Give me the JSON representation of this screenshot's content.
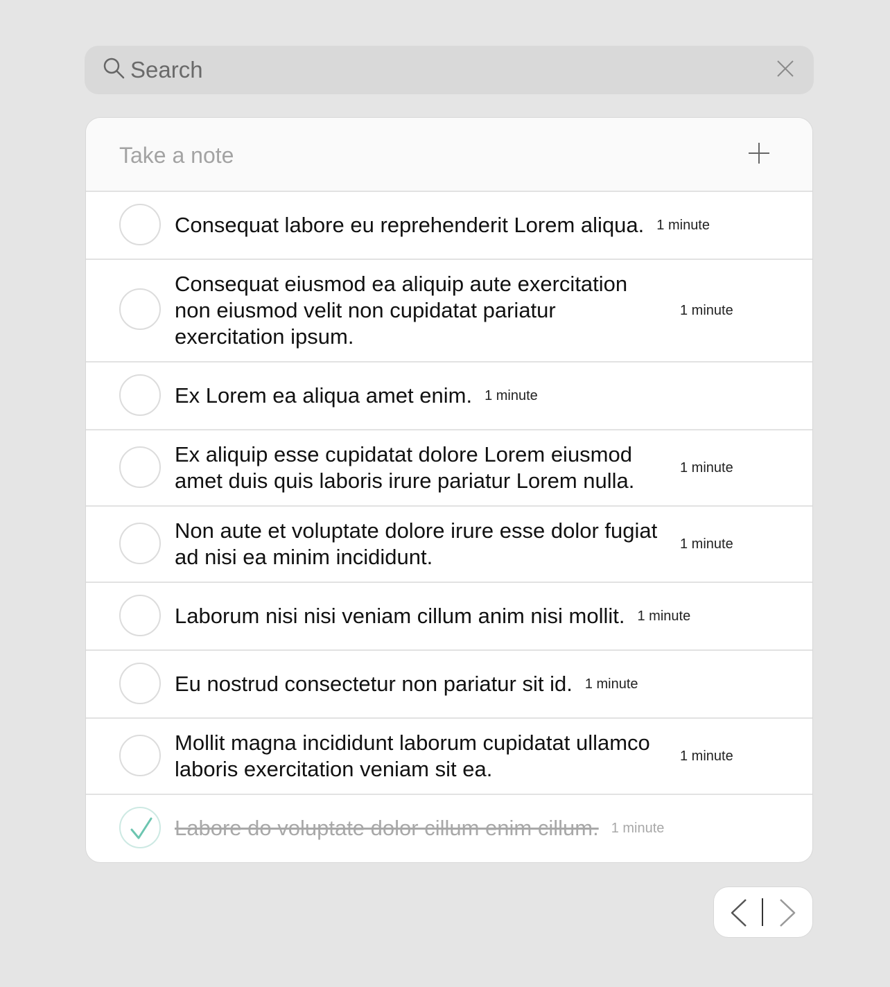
{
  "search": {
    "placeholder": "Search",
    "icon": "search-icon",
    "clear_icon": "close-icon"
  },
  "note": {
    "placeholder": "Take a note",
    "add_icon": "plus-icon"
  },
  "tasks": [
    {
      "text": "Consequat labore eu reprehenderit Lorem aliqua.",
      "time": "1 minute",
      "done": false
    },
    {
      "text": "Consequat eiusmod ea aliquip aute exercitation non eiusmod velit non cupidatat pariatur exercitation ipsum.",
      "time": "1 minute",
      "done": false
    },
    {
      "text": "Ex Lorem ea aliqua amet enim.",
      "time": "1 minute",
      "done": false
    },
    {
      "text": "Ex aliquip esse cupidatat dolore Lorem eiusmod amet duis quis laboris irure pariatur Lorem nulla.",
      "time": "1 minute",
      "done": false
    },
    {
      "text": "Non aute et voluptate dolore irure esse dolor fugiat ad nisi ea minim incididunt.",
      "time": "1 minute",
      "done": false
    },
    {
      "text": "Laborum nisi nisi veniam cillum anim nisi mollit.",
      "time": "1 minute",
      "done": false
    },
    {
      "text": "Eu nostrud consectetur non pariatur sit id.",
      "time": "1 minute",
      "done": false
    },
    {
      "text": "Mollit magna incididunt laborum cupidatat ullamco laboris exercitation veniam sit ea.",
      "time": "1 minute",
      "done": false
    },
    {
      "text": "Labore do voluptate dolor cillum enim cillum.",
      "time": "1 minute",
      "done": true
    }
  ],
  "colors": {
    "check_accent": "#6cc5b0",
    "background": "#e5e5e5"
  },
  "pager": {
    "prev_icon": "chevron-left-icon",
    "next_icon": "chevron-right-icon"
  }
}
